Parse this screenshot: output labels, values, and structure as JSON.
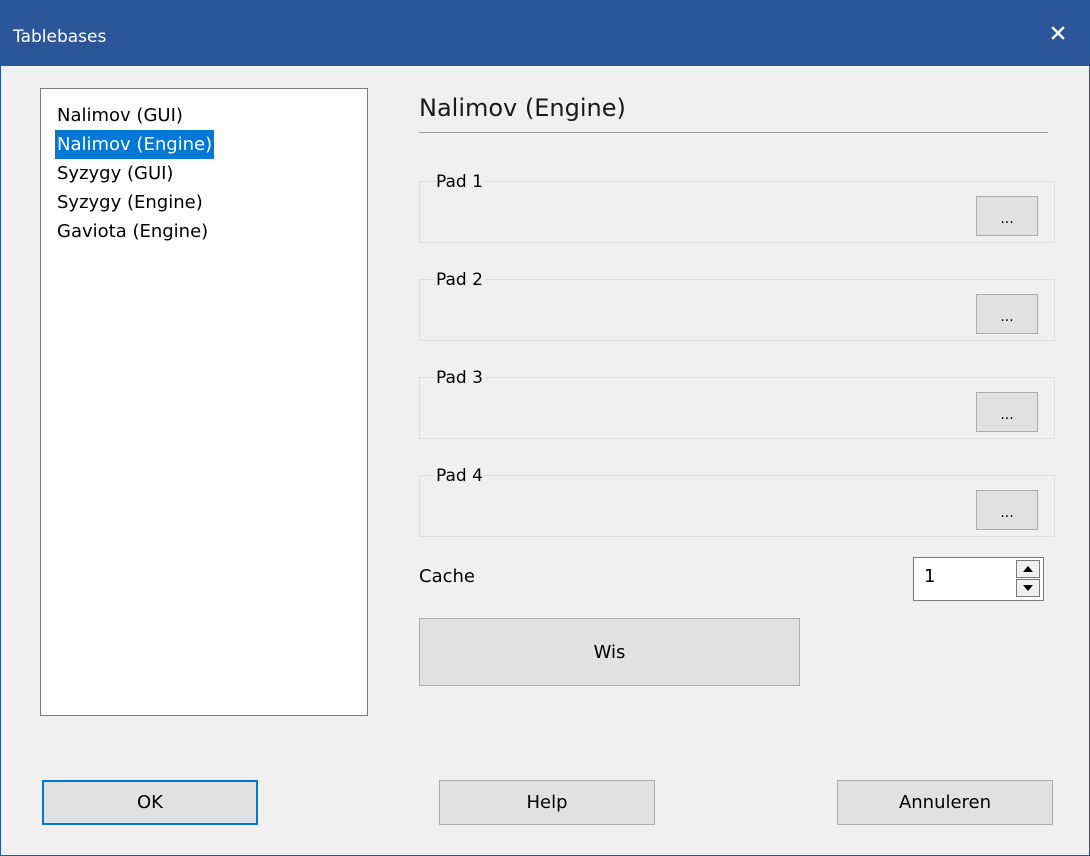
{
  "window": {
    "title": "Tablebases"
  },
  "list": {
    "items": [
      {
        "label": "Nalimov (GUI)",
        "selected": false
      },
      {
        "label": "Nalimov (Engine)",
        "selected": true
      },
      {
        "label": "Syzygy (GUI)",
        "selected": false
      },
      {
        "label": "Syzygy (Engine)",
        "selected": false
      },
      {
        "label": "Gaviota (Engine)",
        "selected": false
      }
    ]
  },
  "panel": {
    "title": "Nalimov (Engine)",
    "paths": [
      {
        "label": "Pad 1",
        "browse_label": "..."
      },
      {
        "label": "Pad 2",
        "browse_label": "..."
      },
      {
        "label": "Pad 3",
        "browse_label": "..."
      },
      {
        "label": "Pad 4",
        "browse_label": "..."
      }
    ],
    "cache": {
      "label": "Cache",
      "value": "1"
    },
    "clear_label": "Wis"
  },
  "footer": {
    "ok_label": "OK",
    "help_label": "Help",
    "cancel_label": "Annuleren"
  },
  "colors": {
    "titlebar": "#2b579a",
    "selection": "#0078d7",
    "dialog_bg": "#f0f0f0"
  },
  "icons": {
    "close": "close-icon",
    "spin_up": "arrow-up-icon",
    "spin_down": "arrow-down-icon"
  }
}
